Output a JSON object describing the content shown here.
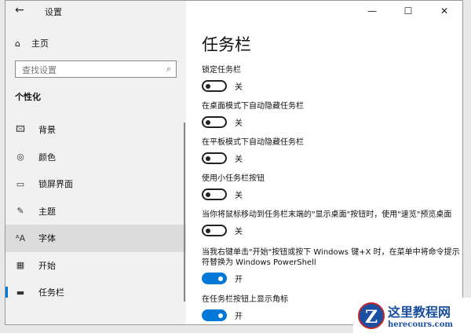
{
  "window": {
    "title": "设置",
    "controls": {
      "minimize": "—",
      "maximize": "☐",
      "close": "✕"
    },
    "back": "←"
  },
  "sidebar": {
    "home": "主页",
    "search_placeholder": "查找设置",
    "section": "个性化",
    "items": [
      {
        "label": "背景",
        "icon": "🖾"
      },
      {
        "label": "颜色",
        "icon": "◎"
      },
      {
        "label": "锁屏界面",
        "icon": "▭"
      },
      {
        "label": "主题",
        "icon": "✎"
      },
      {
        "label": "字体",
        "icon": "ᴬA"
      },
      {
        "label": "开始",
        "icon": "▦"
      },
      {
        "label": "任务栏",
        "icon": "▬"
      }
    ]
  },
  "main": {
    "title": "任务栏",
    "settings": [
      {
        "label": "锁定任务栏",
        "state": "关",
        "on": false
      },
      {
        "label": "在桌面模式下自动隐藏任务栏",
        "state": "关",
        "on": false
      },
      {
        "label": "在平板模式下自动隐藏任务栏",
        "state": "关",
        "on": false
      },
      {
        "label": "使用小任务栏按钮",
        "state": "关",
        "on": false
      },
      {
        "label": "当你将鼠标移动到任务栏末端的\"显示桌面\"按钮时，使用\"速览\"预览桌面",
        "state": "关",
        "on": false
      },
      {
        "label": "当我右键单击\"开始\"按钮或按下 Windows 键+X 时，在菜单中将命令提示符替换为 Windows PowerShell",
        "state": "开",
        "on": true
      },
      {
        "label": "在任务栏按钮上显示角标",
        "state": "开",
        "on": true
      }
    ]
  },
  "watermark": {
    "logo": "Z",
    "name": "这里教程网",
    "url": "herecours.com"
  }
}
